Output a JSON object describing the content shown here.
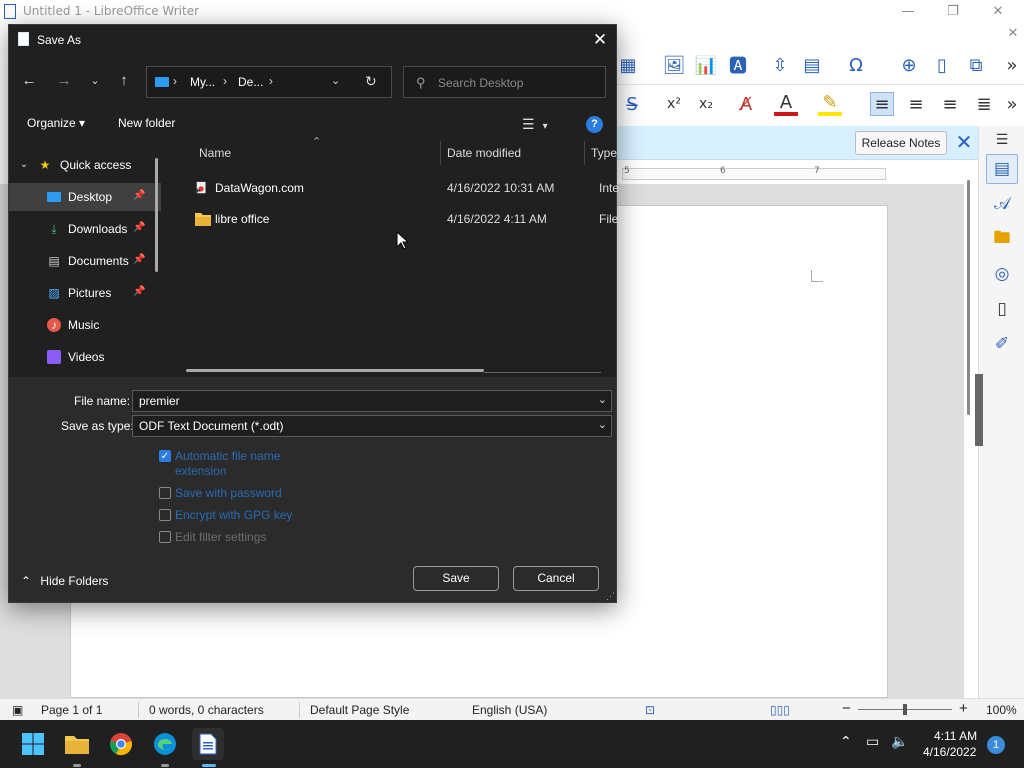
{
  "writer": {
    "title": "Untitled 1 - LibreOffice Writer",
    "window_controls": {
      "minimize": "—",
      "restore": "❐",
      "close": "✕"
    },
    "toolbar_overflow": "»",
    "infobar": {
      "release_notes": "Release Notes",
      "close": "✕"
    },
    "ruler_numbers": [
      "5",
      "6",
      "7"
    ],
    "statusbar": {
      "page": "Page 1 of 1",
      "words": "0 words, 0 characters",
      "page_style": "Default Page Style",
      "language": "English (USA)",
      "zoom": "100%",
      "zoom_minus": "−",
      "zoom_plus": "+"
    }
  },
  "dialog": {
    "title": "Save As",
    "close": "✕",
    "address": {
      "crumb1": "My...",
      "crumb2": "De...",
      "sep": "›"
    },
    "search": {
      "placeholder": "Search Desktop"
    },
    "commands": {
      "organize": "Organize ▾",
      "new_folder": "New folder",
      "help": "?"
    },
    "nav_pane": {
      "quick_access": "Quick access",
      "items": [
        {
          "label": "Desktop",
          "pinned": true,
          "selected": true
        },
        {
          "label": "Downloads",
          "pinned": true
        },
        {
          "label": "Documents",
          "pinned": true
        },
        {
          "label": "Pictures",
          "pinned": true
        },
        {
          "label": "Music"
        },
        {
          "label": "Videos"
        }
      ]
    },
    "columns": {
      "name": "Name",
      "date_modified": "Date modified",
      "type": "Type"
    },
    "files": [
      {
        "name": "DataWagon.com",
        "date": "4/16/2022 10:31 AM",
        "type": "Intern",
        "icon": "internet-shortcut-icon"
      },
      {
        "name": "libre office",
        "date": "4/16/2022 4:11 AM",
        "type": "File fo",
        "icon": "folder-icon"
      }
    ],
    "file_name": {
      "label": "File name:",
      "value": "premier"
    },
    "save_as_type": {
      "label": "Save as type:",
      "value": "ODF Text Document (*.odt)"
    },
    "options": [
      {
        "label": "Automatic file name extension",
        "checked": true
      },
      {
        "label": "Save with password",
        "checked": false
      },
      {
        "label": "Encrypt with GPG key",
        "checked": false
      },
      {
        "label": "Edit filter settings",
        "checked": false,
        "disabled": true
      }
    ],
    "hide_folders": "Hide Folders",
    "save": "Save",
    "cancel": "Cancel"
  },
  "taskbar": {
    "time": "4:11 AM",
    "date": "4/16/2022",
    "notifications": "1"
  },
  "colors": {
    "dialog_bg": "#202020",
    "accent": "#2d7de0",
    "taskbar_bg": "#202020",
    "infobar_bg": "#d7efff"
  }
}
